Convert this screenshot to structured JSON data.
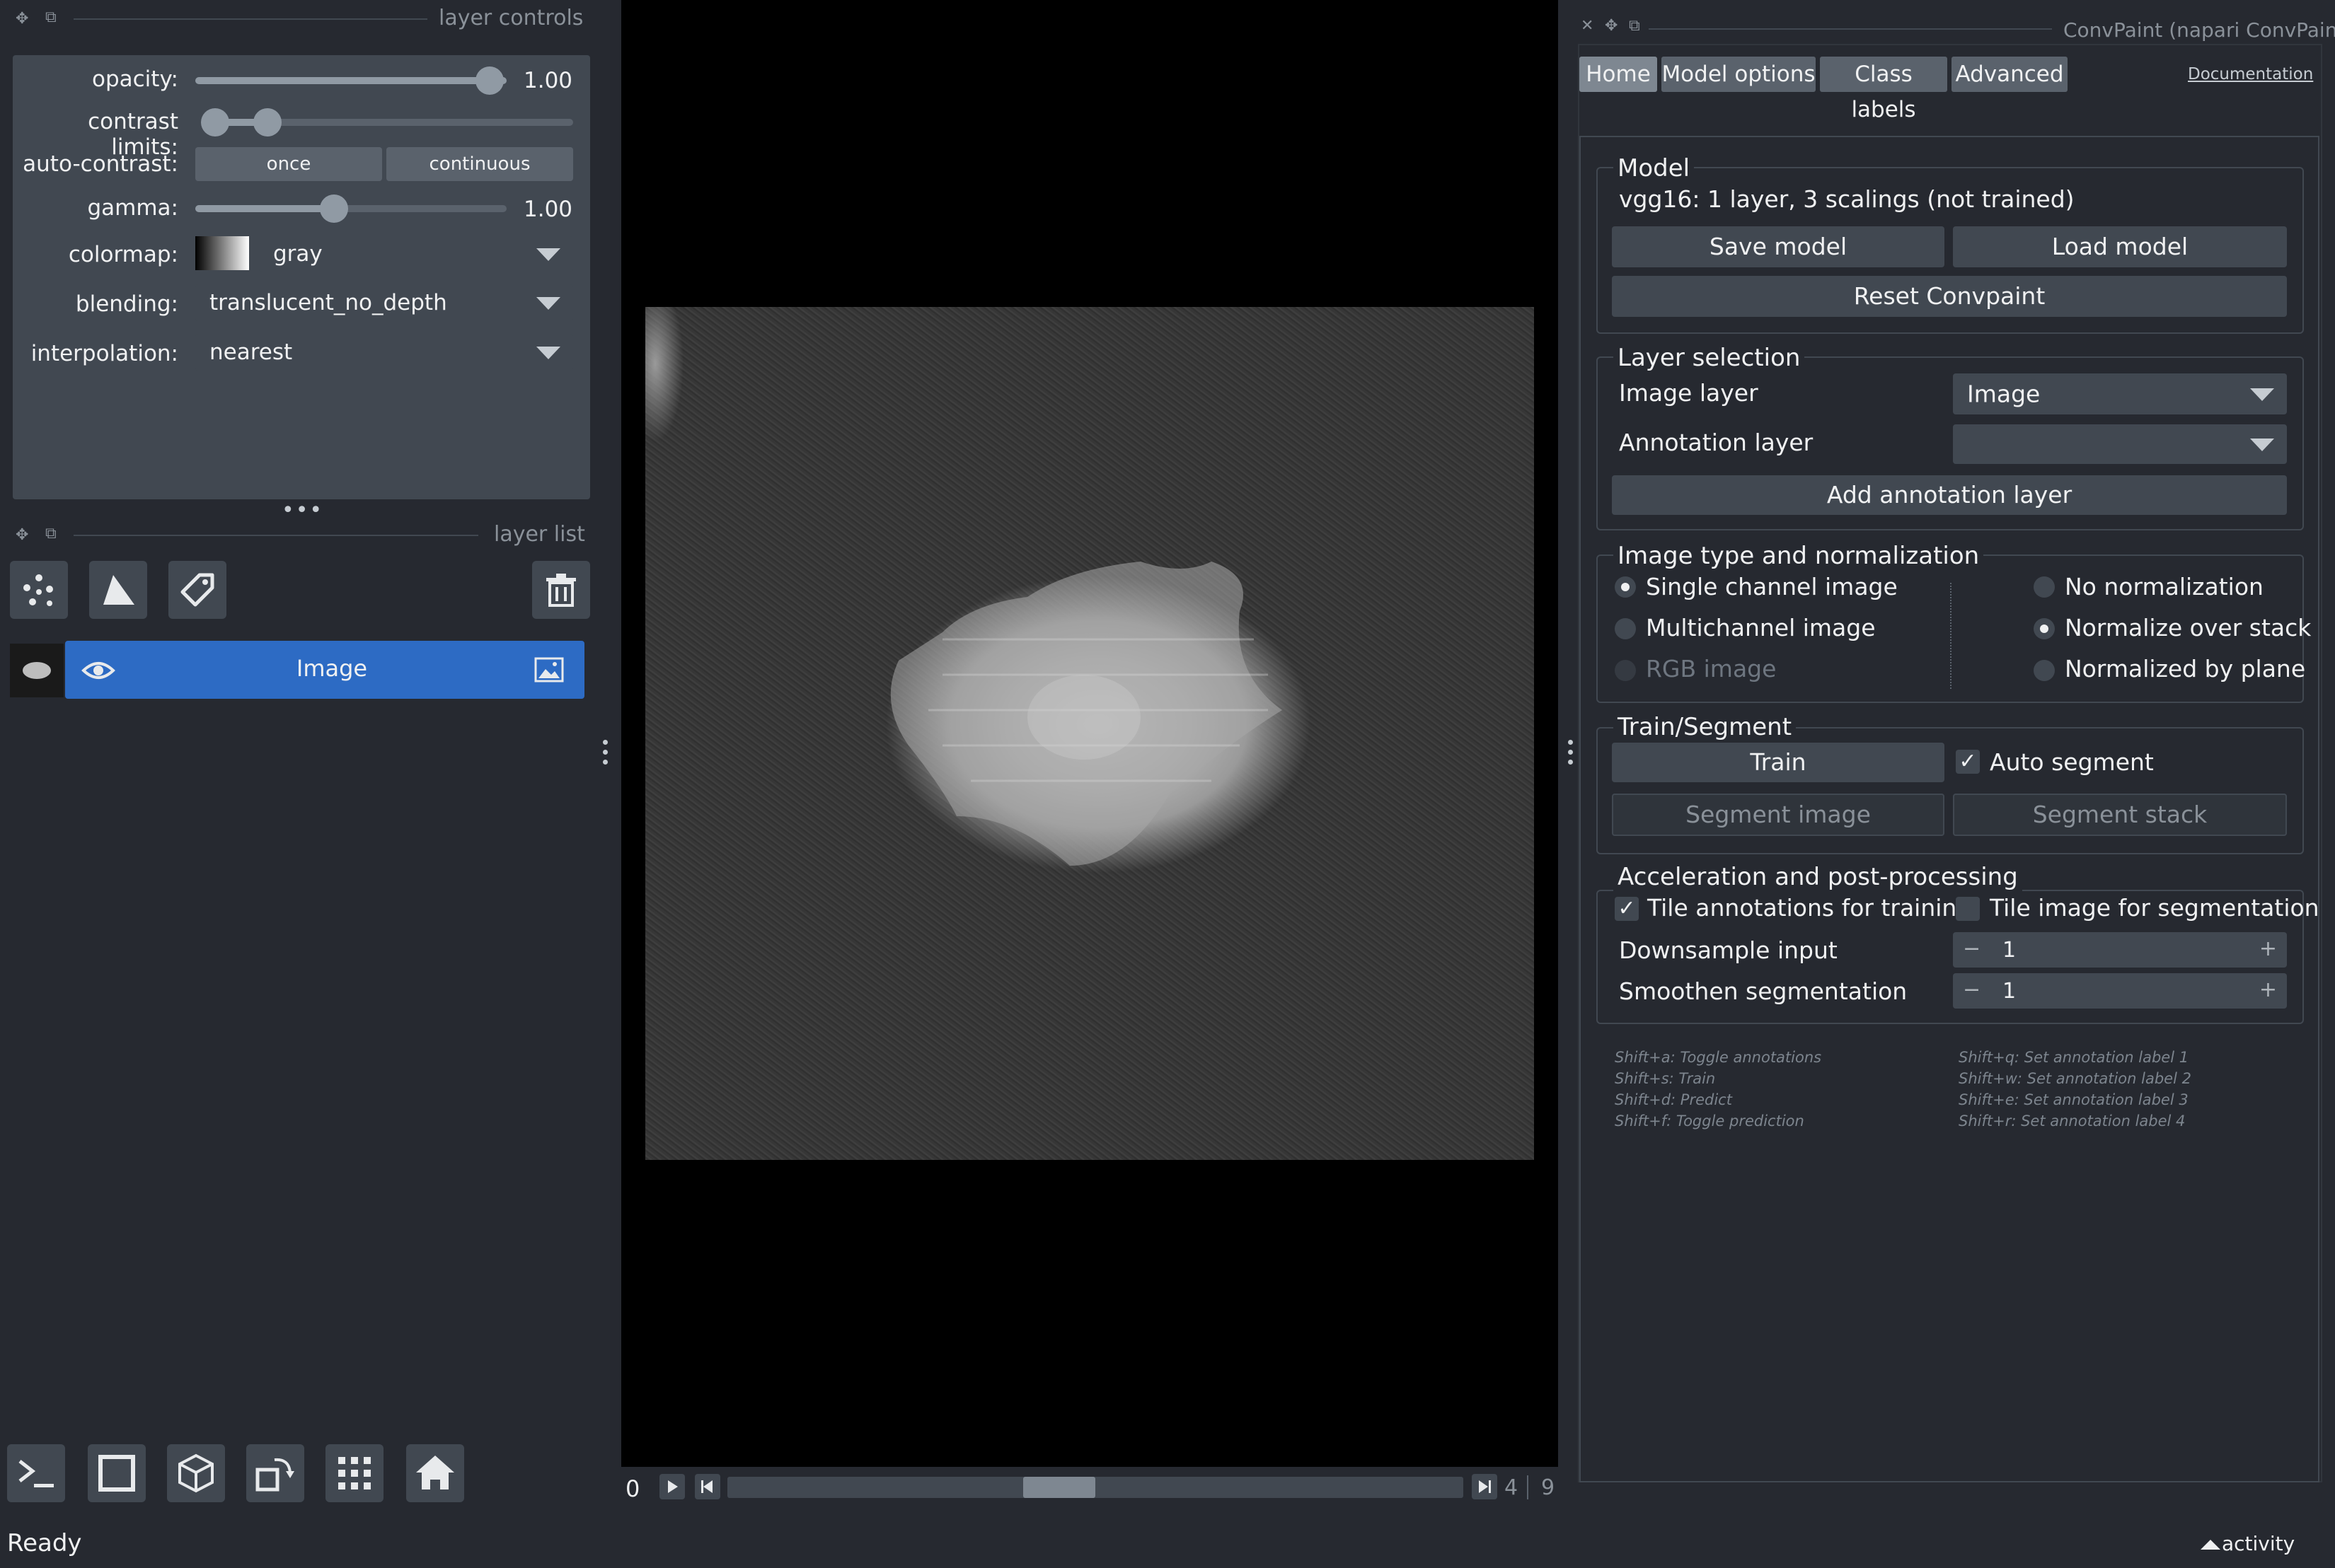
{
  "layer_controls": {
    "header": "layer controls",
    "opacity_label": "opacity:",
    "opacity_value": "1.00",
    "opacity_fraction": 1.0,
    "contrast_label": "contrast limits:",
    "autocontrast_label": "auto-contrast:",
    "once_label": "once",
    "continuous_label": "continuous",
    "gamma_label": "gamma:",
    "gamma_value": "1.00",
    "colormap_label": "colormap:",
    "colormap_value": "gray",
    "blending_label": "blending:",
    "blending_value": "translucent_no_depth",
    "interpolation_label": "interpolation:",
    "interpolation_value": "nearest"
  },
  "layer_list": {
    "header": "layer list",
    "layers": [
      {
        "name": "Image"
      }
    ]
  },
  "dims": {
    "start_label": "0",
    "current": "4",
    "total": "9"
  },
  "status": {
    "ready": "Ready",
    "activity": "activity"
  },
  "plugin": {
    "title": "ConvPaint (napari ConvPaint)",
    "tabs": [
      "Home",
      "Model options",
      "Class labels",
      "Advanced"
    ],
    "documentation": "Documentation",
    "model": {
      "title": "Model",
      "description": "vgg16: 1 layer, 3 scalings (not trained)",
      "save": "Save model",
      "load": "Load model",
      "reset": "Reset Convpaint"
    },
    "layer_selection": {
      "title": "Layer selection",
      "image_layer_label": "Image layer",
      "image_layer_value": "Image",
      "annotation_layer_label": "Annotation layer",
      "annotation_layer_value": "",
      "add_annotation": "Add annotation layer"
    },
    "image_type": {
      "title": "Image type and normalization",
      "single": "Single channel image",
      "multi": "Multichannel image",
      "rgb": "RGB image",
      "no_norm": "No normalization",
      "norm_stack": "Normalize over stack",
      "norm_plane": "Normalized by plane"
    },
    "train_segment": {
      "title": "Train/Segment",
      "train": "Train",
      "auto_segment": "Auto segment",
      "segment_image": "Segment image",
      "segment_stack": "Segment stack"
    },
    "accel": {
      "title": "Acceleration and post-processing",
      "tile_annotations": "Tile annotations for training",
      "tile_image": "Tile image for segmentation",
      "downsample_label": "Downsample input",
      "downsample_value": "1",
      "smoothen_label": "Smoothen segmentation",
      "smoothen_value": "1",
      "minus": "−",
      "plus": "+"
    },
    "shortcuts_left": [
      "Shift+a: Toggle annotations",
      "Shift+s: Train",
      "Shift+d: Predict",
      "Shift+f: Toggle prediction"
    ],
    "shortcuts_right": [
      "Shift+q: Set annotation label 1",
      "Shift+w: Set annotation label 2",
      "Shift+e: Set annotation label 3",
      "Shift+r: Set annotation label 4"
    ]
  }
}
